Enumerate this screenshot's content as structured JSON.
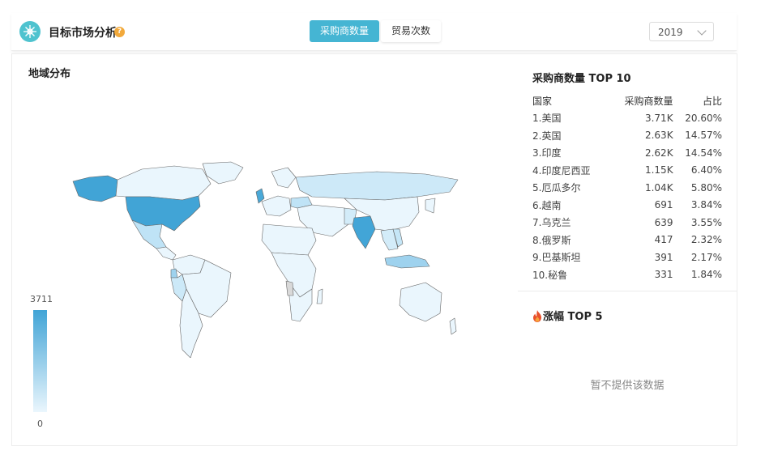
{
  "header": {
    "title": "目标市场分析",
    "help_icon": "question-mark-icon",
    "tabs": [
      {
        "label": "采购商数量",
        "active": true
      },
      {
        "label": "贸易次数",
        "active": false
      }
    ],
    "year": "2019"
  },
  "map_section": {
    "title": "地域分布",
    "legend_max": "3711",
    "legend_min": "0",
    "colors": {
      "max": "#41a4d6",
      "min": "#eaf6fd",
      "no_data": "#d9d9d9",
      "border": "#666666"
    }
  },
  "top10": {
    "title": "采购商数量 TOP 10",
    "columns": [
      "国家",
      "采购商数量",
      "占比"
    ],
    "rows": [
      {
        "country": "1.美国",
        "count": "3.71K",
        "share": "20.60%"
      },
      {
        "country": "2.英国",
        "count": "2.63K",
        "share": "14.57%"
      },
      {
        "country": "3.印度",
        "count": "2.62K",
        "share": "14.54%"
      },
      {
        "country": "4.印度尼西亚",
        "count": "1.15K",
        "share": "6.40%"
      },
      {
        "country": "5.厄瓜多尔",
        "count": "1.04K",
        "share": "5.80%"
      },
      {
        "country": "6.越南",
        "count": "691",
        "share": "3.84%"
      },
      {
        "country": "7.乌克兰",
        "count": "639",
        "share": "3.55%"
      },
      {
        "country": "8.俄罗斯",
        "count": "417",
        "share": "2.32%"
      },
      {
        "country": "9.巴基斯坦",
        "count": "391",
        "share": "2.17%"
      },
      {
        "country": "10.秘鲁",
        "count": "331",
        "share": "1.84%"
      }
    ]
  },
  "growth": {
    "title": "涨幅 TOP 5",
    "icon": "fire-icon",
    "empty_text": "暂不提供该数据"
  },
  "accent_color": "#45b5d3"
}
